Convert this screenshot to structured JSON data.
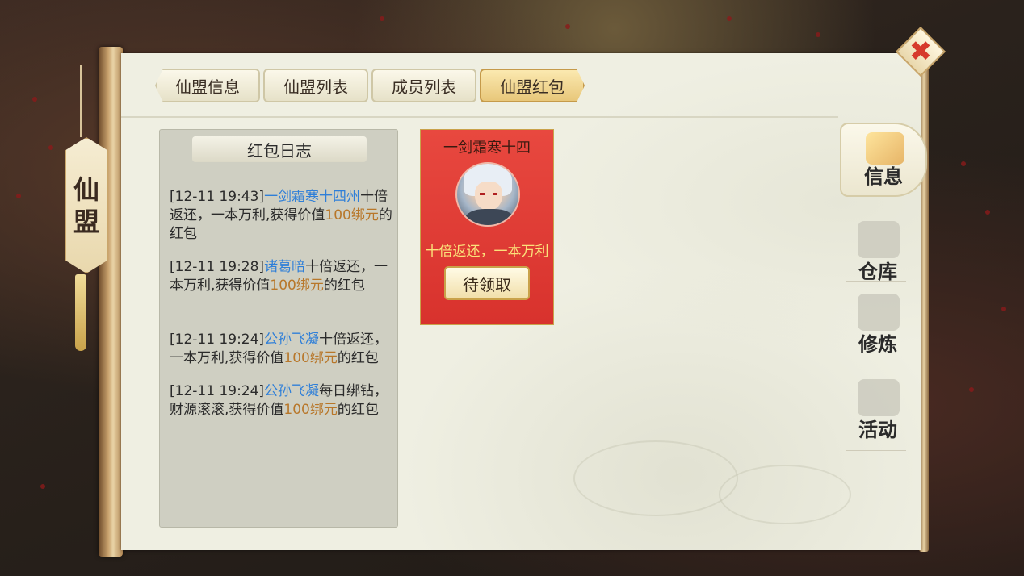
{
  "guild_tag": {
    "char1": "仙",
    "char2": "盟"
  },
  "tabs": [
    {
      "label": "仙盟信息"
    },
    {
      "label": "仙盟列表"
    },
    {
      "label": "成员列表"
    },
    {
      "label": "仙盟红包"
    }
  ],
  "log": {
    "title": "红包日志",
    "entries": [
      {
        "time": "[12-11 19:43]",
        "name": "一剑霜寒十四州",
        "text1": "十倍返还，一本万利,获得价值",
        "amount": "100绑元",
        "text2": "的红包"
      },
      {
        "time": "[12-11 19:28]",
        "name": "诸葛暗",
        "text1": "十倍返还，一本万利,获得价值",
        "amount": "100绑元",
        "text2": "的红包"
      },
      {
        "time": "[12-11 19:24]",
        "name": "公孙飞凝",
        "text1": "十倍返还，一本万利,获得价值",
        "amount": "100绑元",
        "text2": "的红包"
      },
      {
        "time": "[12-11 19:24]",
        "name": "公孙飞凝",
        "text1": "每日绑钻，财源滚滚,获得价值",
        "amount": "100绑元",
        "text2": "的红包"
      }
    ]
  },
  "packet": {
    "sender": "一剑霜寒十四",
    "slogan": "十倍返还，一本万利",
    "button": "待领取"
  },
  "side_tabs": [
    {
      "label": "信息",
      "icon": "info-scroll-icon"
    },
    {
      "label": "仓库",
      "icon": "warehouse-icon"
    },
    {
      "label": "修炼",
      "icon": "cultivate-icon"
    },
    {
      "label": "活动",
      "icon": "activity-icon"
    }
  ],
  "close": {
    "label": "✖"
  },
  "colors": {
    "link_blue": "#2f7fd8",
    "amount_gold": "#b8772a",
    "packet_red": "#e8483f",
    "slogan_yellow": "#fbe27a"
  }
}
